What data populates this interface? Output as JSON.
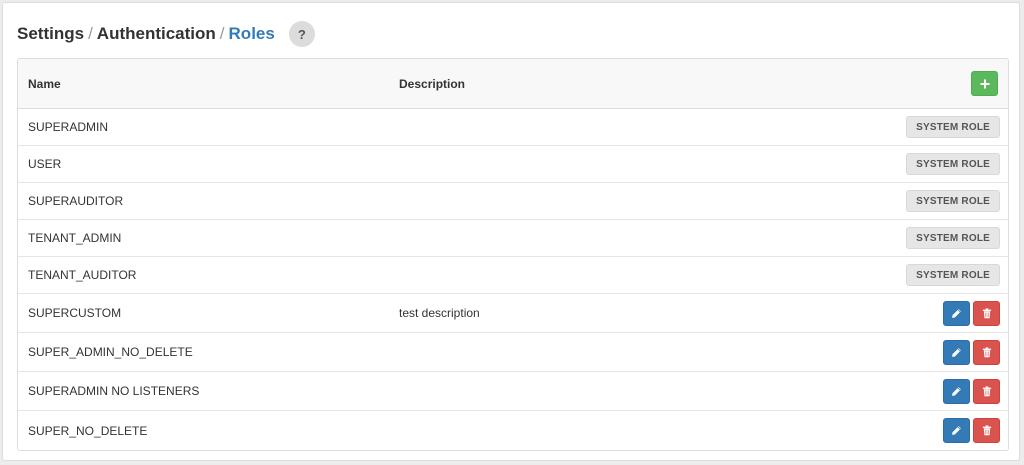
{
  "breadcrumb": {
    "items": [
      "Settings",
      "Authentication",
      "Roles"
    ],
    "separator": "/",
    "help_label": "?"
  },
  "table": {
    "columns": {
      "name": "Name",
      "description": "Description"
    },
    "add_button_icon": "plus-icon",
    "rows": [
      {
        "name": "SUPERADMIN",
        "description": "",
        "system": true,
        "badge": "SYSTEM ROLE"
      },
      {
        "name": "USER",
        "description": "",
        "system": true,
        "badge": "SYSTEM ROLE"
      },
      {
        "name": "SUPERAUDITOR",
        "description": "",
        "system": true,
        "badge": "SYSTEM ROLE"
      },
      {
        "name": "TENANT_ADMIN",
        "description": "",
        "system": true,
        "badge": "SYSTEM ROLE"
      },
      {
        "name": "TENANT_AUDITOR",
        "description": "",
        "system": true,
        "badge": "SYSTEM ROLE"
      },
      {
        "name": "SUPERCUSTOM",
        "description": "test description",
        "system": false
      },
      {
        "name": "SUPER_ADMIN_NO_DELETE",
        "description": "",
        "system": false
      },
      {
        "name": "SUPERADMIN NO LISTENERS",
        "description": "",
        "system": false
      },
      {
        "name": "SUPER_NO_DELETE",
        "description": "",
        "system": false
      }
    ]
  },
  "colors": {
    "accent": "#337ab7",
    "add": "#5cb85c",
    "delete": "#d9534f",
    "badge_bg": "#e6e6e6"
  }
}
